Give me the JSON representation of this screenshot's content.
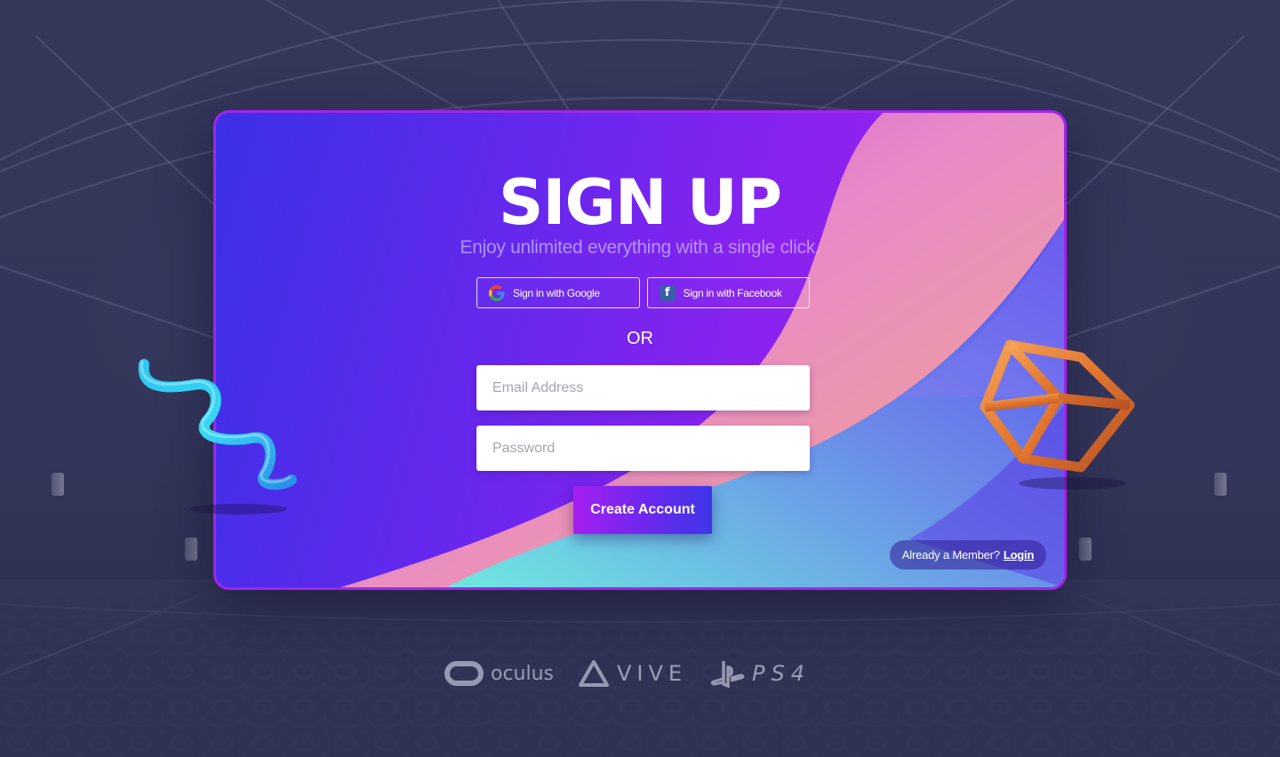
{
  "page": {
    "title": "SIGN UP",
    "subtitle": "Enjoy unlimited everything with a single click."
  },
  "social": {
    "google_label": "Sign in with Google",
    "facebook_label": "Sign in with Facebook"
  },
  "divider": "OR",
  "form": {
    "email_placeholder": "Email Address",
    "email_value": "",
    "password_placeholder": "Password",
    "password_value": "",
    "submit_label": "Create Account"
  },
  "footer": {
    "member_text": "Already a Member?",
    "login_label": "Login"
  },
  "brands": {
    "oculus": "oculus",
    "vive": "VIVE",
    "ps4": "PS4"
  },
  "colors": {
    "background": "#343659",
    "card_gradient_start": "#3a31e6",
    "card_gradient_end": "#a21fe6",
    "accent_purple": "#a520f0",
    "accent_blue": "#3f36e8",
    "wave_cyan": "#6ee9e0",
    "wave_pink": "#e889c4"
  },
  "icons": [
    "google-icon",
    "facebook-icon",
    "oculus-logo-icon",
    "vive-logo-icon",
    "playstation-logo-icon"
  ]
}
